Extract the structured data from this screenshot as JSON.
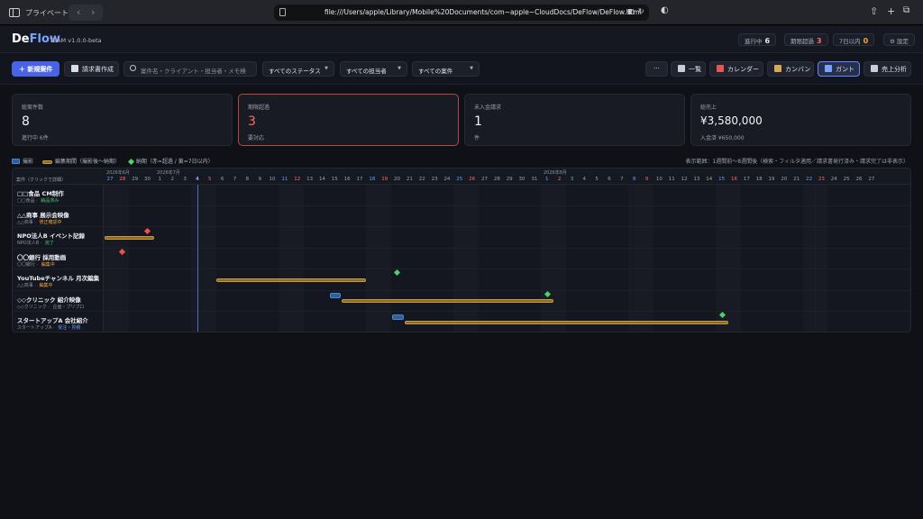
{
  "browser": {
    "private_label": "プライベート",
    "url": "file:///Users/apple/Library/Mobile%20Documents/com~apple~CloudDocs/DeFlow/DeFlow.html"
  },
  "app": {
    "logo_de": "De",
    "logo_flow": "Flow",
    "team_tag": "TEAM",
    "version": "v1.0.0-beta",
    "pills": [
      {
        "label": "進行中",
        "value": "6",
        "color": "#e6e8ee"
      },
      {
        "label": "期限超過",
        "value": "3",
        "color": "#ff6b5e"
      },
      {
        "label": "7日以内",
        "value": "0",
        "color": "#f4a53a"
      }
    ],
    "settings_label": "設定"
  },
  "toolbar": {
    "new_project": "＋ 新規案件",
    "invoice": "請求書作成",
    "search_placeholder": "案件名・クライアント・担当者・メモ検",
    "status_filter": "すべてのステータス",
    "assignee_filter": "すべての担当者",
    "project_filter": "すべての案件",
    "more": "···",
    "views": [
      {
        "label": "一覧",
        "icon": "list-icon"
      },
      {
        "label": "カレンダー",
        "icon": "calendar-icon"
      },
      {
        "label": "カンバン",
        "icon": "kanban-icon"
      },
      {
        "label": "ガント",
        "icon": "gantt-icon"
      },
      {
        "label": "売上分析",
        "icon": "analytics-icon"
      }
    ]
  },
  "stats": [
    {
      "label": "総案件数",
      "value": "8",
      "sub": "進行中 6件"
    },
    {
      "label": "期限超過",
      "value": "3",
      "sub": "要対応"
    },
    {
      "label": "未入金請求",
      "value": "1",
      "sub": "件"
    },
    {
      "label": "総売上",
      "value": "¥3,580,000",
      "sub": "入金済 ¥650,000"
    }
  ],
  "legend": {
    "shoot": "撮影",
    "edit": "編集期間（撮影後〜納期）",
    "due": "納期（赤=超過 / 黄=7日以内）",
    "range_note": "表示範囲：1週間前〜8週間後（検索・フィルタ適用／請求書発行済み・請求完了は非表示）"
  },
  "gantt": {
    "column_header": "案件（クリックで詳細）",
    "months": [
      {
        "label": "2026年6月"
      },
      {
        "label": "2026年7月"
      },
      {
        "label": "2026年8月"
      }
    ],
    "days": [
      "27",
      "28",
      "29",
      "30",
      "1",
      "2",
      "3",
      "4",
      "5",
      "6",
      "7",
      "8",
      "9",
      "10",
      "11",
      "12",
      "13",
      "14",
      "15",
      "16",
      "17",
      "18",
      "19",
      "20",
      "21",
      "22",
      "23",
      "24",
      "25",
      "26",
      "27",
      "28",
      "29",
      "30",
      "31",
      "1",
      "2",
      "3",
      "4",
      "5",
      "6",
      "7",
      "8",
      "9",
      "10",
      "11",
      "12",
      "13",
      "14",
      "15",
      "16",
      "17",
      "18",
      "19",
      "20",
      "21",
      "22",
      "23",
      "24",
      "25",
      "26",
      "27"
    ],
    "rows": [
      {
        "name": "□□食品 CM制作",
        "client": "□□食品",
        "status": "納品済み",
        "status_color": "#4ccf6d"
      },
      {
        "name": "△△商事 展示会映像",
        "client": "△△商事",
        "status": "修正確認中",
        "status_color": "#f4a53a"
      },
      {
        "name": "NPO法人B イベント記録",
        "client": "NPO法人B",
        "status": "完了",
        "status_color": "#4ccf6d"
      },
      {
        "name": "〇〇銀行 採用動画",
        "client": "〇〇銀行",
        "status": "編集中",
        "status_color": "#f4a53a"
      },
      {
        "name": "YouTubeチャンネル 月次編集",
        "client": "△△商事",
        "status": "編集中",
        "status_color": "#f4a53a"
      },
      {
        "name": "◇◇クリニック 紹介映像",
        "client": "◇◇クリニック",
        "status": "企画・プリプロ",
        "status_color": "#8e94a1"
      },
      {
        "name": "スタートアップA 会社紹介",
        "client": "スタートアップA",
        "status": "受注・見積",
        "status_color": "#6e9cff"
      }
    ]
  }
}
